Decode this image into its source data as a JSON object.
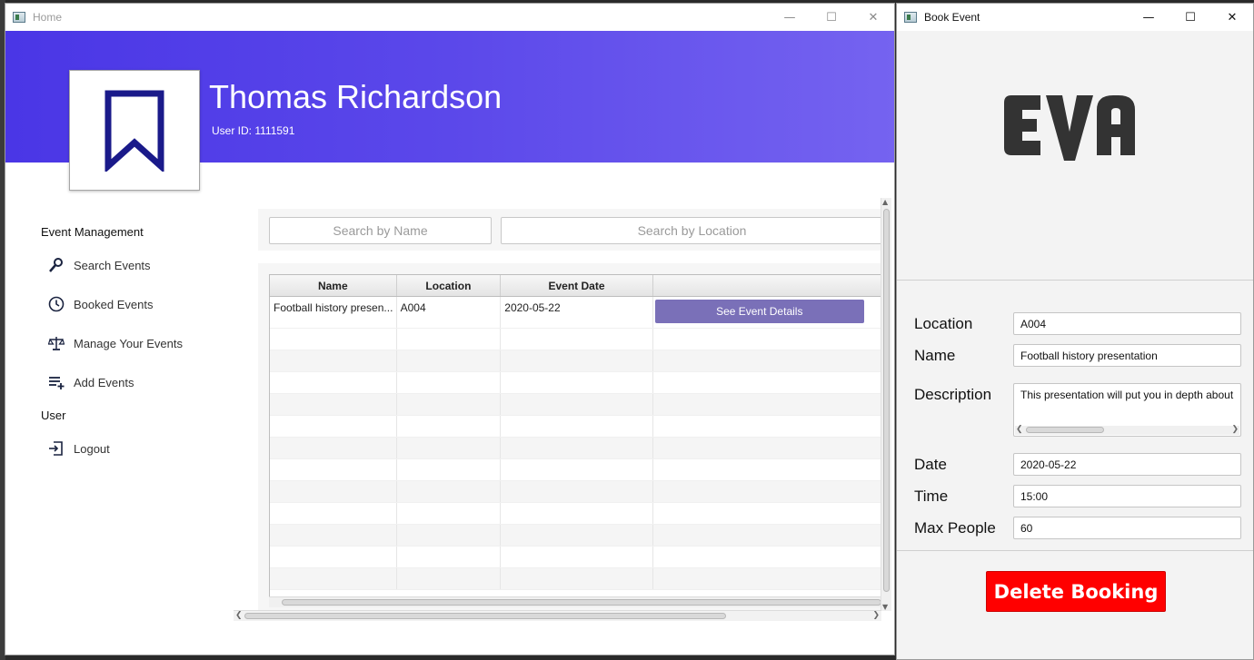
{
  "home_window": {
    "title": "Home",
    "user": {
      "name": "Thomas Richardson",
      "id_label": "User ID: 1111591"
    },
    "nav": {
      "section_event": "Event Management",
      "items": [
        {
          "label": "Search Events",
          "icon": "search-icon"
        },
        {
          "label": "Booked Events",
          "icon": "clock-icon"
        },
        {
          "label": "Manage Your Events",
          "icon": "scales-icon"
        },
        {
          "label": "Add Events",
          "icon": "add-list-icon"
        }
      ],
      "section_user": "User",
      "logout": {
        "label": "Logout",
        "icon": "logout-icon"
      }
    },
    "search": {
      "name_placeholder": "Search by Name",
      "location_placeholder": "Search by Location"
    },
    "table": {
      "columns": [
        "Name",
        "Location",
        "Event Date",
        ""
      ],
      "rows": [
        {
          "name": "Football history presen...",
          "location": "A004",
          "date": "2020-05-22",
          "action": "See Event Details"
        }
      ]
    }
  },
  "book_window": {
    "title": "Book Event",
    "logo_text": "EVA",
    "fields": {
      "location": {
        "label": "Location",
        "value": "A004"
      },
      "name": {
        "label": "Name",
        "value": "Football history presentation"
      },
      "description": {
        "label": "Description",
        "value": "This presentation will put you in depth about"
      },
      "date": {
        "label": "Date",
        "value": "2020-05-22"
      },
      "time": {
        "label": "Time",
        "value": "15:00"
      },
      "max_people": {
        "label": "Max People",
        "value": "60"
      }
    },
    "delete_button": "Delete Booking"
  },
  "colors": {
    "header_gradient_start": "#4a36e6",
    "header_gradient_end": "#7563f0",
    "button_purple": "#7a70b8",
    "delete_red": "#ff0000",
    "logo_navy": "#1a1a8a"
  }
}
